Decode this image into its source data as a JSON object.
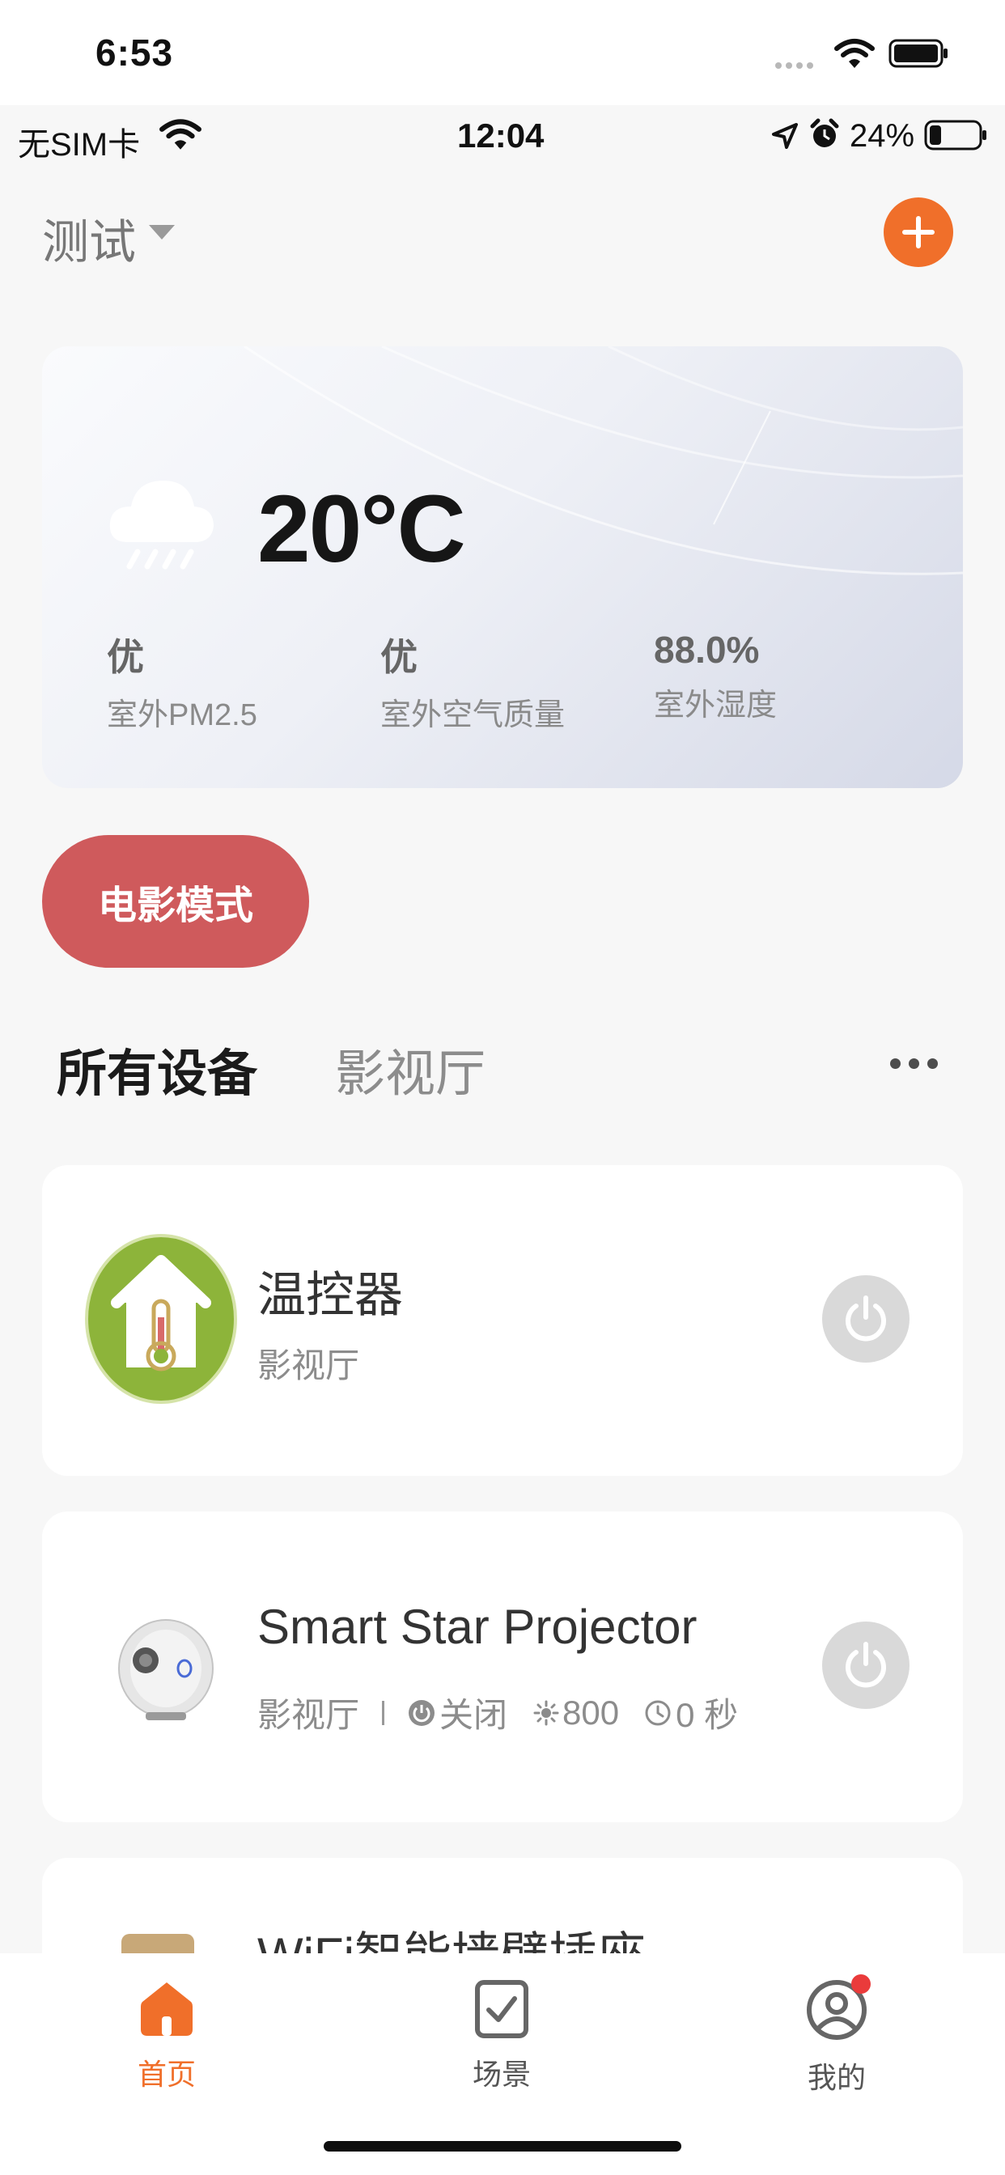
{
  "outer_status": {
    "time": "6:53"
  },
  "status_bar": {
    "carrier": "无SIM卡",
    "time": "12:04",
    "battery": "24%"
  },
  "header": {
    "home_name": "测试"
  },
  "weather": {
    "temperature": "20°C",
    "stats": [
      {
        "value": "优",
        "label": "室外PM2.5"
      },
      {
        "value": "优",
        "label": "室外空气质量"
      },
      {
        "value": "88.0%",
        "label": "室外湿度"
      }
    ]
  },
  "scene": {
    "label": "电影模式"
  },
  "tabs": [
    {
      "label": "所有设备"
    },
    {
      "label": "影视厅"
    }
  ],
  "devices": [
    {
      "name": "温控器",
      "room": "影视厅"
    },
    {
      "name": "Smart Star Projector",
      "room": "影视厅",
      "power_status": "关闭",
      "brightness": "800",
      "timer": "0 秒"
    },
    {
      "name": "WiFi智能墙壁插座"
    }
  ],
  "tabbar": {
    "items": [
      {
        "label": "首页"
      },
      {
        "label": "场景"
      },
      {
        "label": "我的"
      }
    ]
  },
  "colors": {
    "accent": "#f06f2a",
    "scene_chip": "#cf5a5c",
    "active_tab": "#f06f2a",
    "badge": "#ea3b3b"
  },
  "icons": {
    "weather": "rain-cloud-icon",
    "add": "plus-icon",
    "power": "power-icon",
    "home": "home-icon",
    "scene": "checkbox-icon",
    "profile": "user-circle-icon"
  }
}
